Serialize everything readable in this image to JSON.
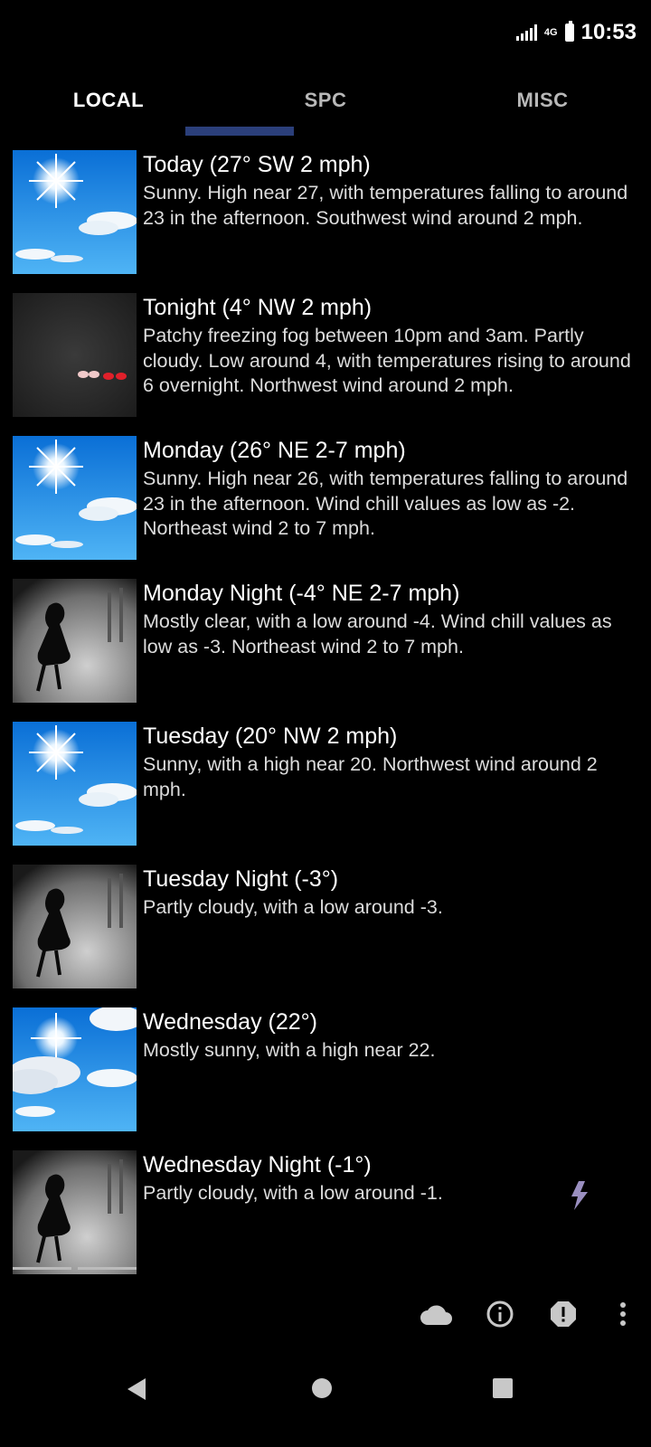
{
  "status": {
    "time": "10:53",
    "network": "4G"
  },
  "tabs": [
    {
      "label": "LOCAL",
      "active": true
    },
    {
      "label": "SPC",
      "active": false
    },
    {
      "label": "MISC",
      "active": false
    }
  ],
  "forecast": [
    {
      "title": "Today (27° SW 2 mph)",
      "desc": "Sunny. High near 27, with temperatures falling to around 23 in the afternoon. Southwest wind around 2 mph.",
      "icon": "sunny-icon"
    },
    {
      "title": "Tonight (4° NW 2 mph)",
      "desc": "Patchy freezing fog between 10pm and 3am. Partly cloudy. Low around 4, with temperatures rising to around 6 overnight. Northwest wind around 2 mph.",
      "icon": "fog-icon"
    },
    {
      "title": "Monday (26° NE 2-7 mph)",
      "desc": "Sunny. High near 26, with temperatures falling to around 23 in the afternoon. Wind chill values as low as -2. Northeast wind 2 to 7 mph.",
      "icon": "sunny-icon"
    },
    {
      "title": "Monday Night (-4° NE 2-7 mph)",
      "desc": "Mostly clear, with a low around -4. Wind chill values as low as -3. Northeast wind 2 to 7 mph.",
      "icon": "cold-night-icon"
    },
    {
      "title": "Tuesday (20° NW 2 mph)",
      "desc": "Sunny, with a high near 20. Northwest wind around 2 mph.",
      "icon": "sunny-icon"
    },
    {
      "title": "Tuesday Night (-3°)",
      "desc": "Partly cloudy, with a low around -3.",
      "icon": "cold-night-icon"
    },
    {
      "title": "Wednesday (22°)",
      "desc": "Mostly sunny, with a high near 22.",
      "icon": "mostly-sunny-icon"
    },
    {
      "title": "Wednesday Night (-1°)",
      "desc": "Partly cloudy, with a low around -1.",
      "icon": "cold-night-icon"
    }
  ],
  "toolbar": [
    "cloud-icon",
    "info-icon",
    "alert-icon",
    "more-vert-icon"
  ],
  "colors": {
    "accent_lightning": "#9a8fc0",
    "sky_blue": "#1e8fe0"
  }
}
